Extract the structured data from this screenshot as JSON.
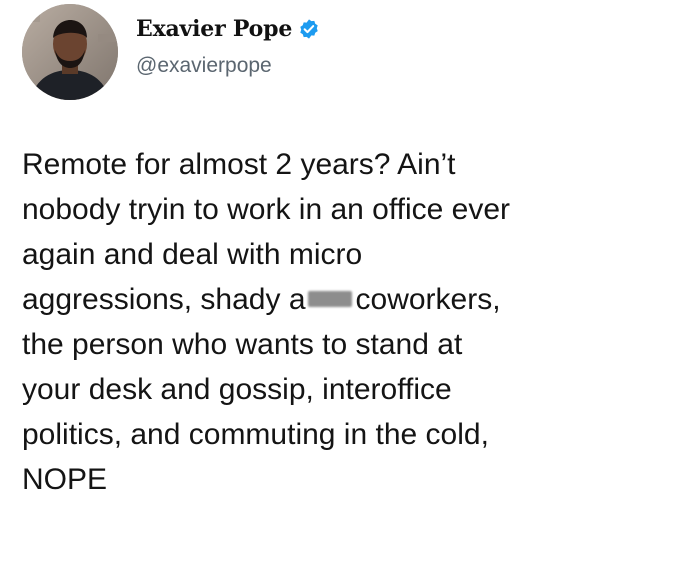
{
  "author": {
    "display_name": "Exavier Pope",
    "handle": "@exavierpope",
    "verified_badge_icon": "verified-badge-icon",
    "badge_color": "#1d9bf0"
  },
  "tweet": {
    "lines": [
      "Remote for almost 2 years? Ain’t",
      "nobody tryin to work in an office ever",
      "again and deal with micro"
    ],
    "line4_before": "aggressions, shady a",
    "line4_after": "coworkers,",
    "lines_after": [
      "the person who wants to stand at",
      "your desk and gossip, interoffice",
      "politics, and commuting in the cold,",
      "NOPE"
    ]
  },
  "colors": {
    "text": "#141414",
    "handle": "#5b6670",
    "redaction": "#8d8d8d"
  }
}
